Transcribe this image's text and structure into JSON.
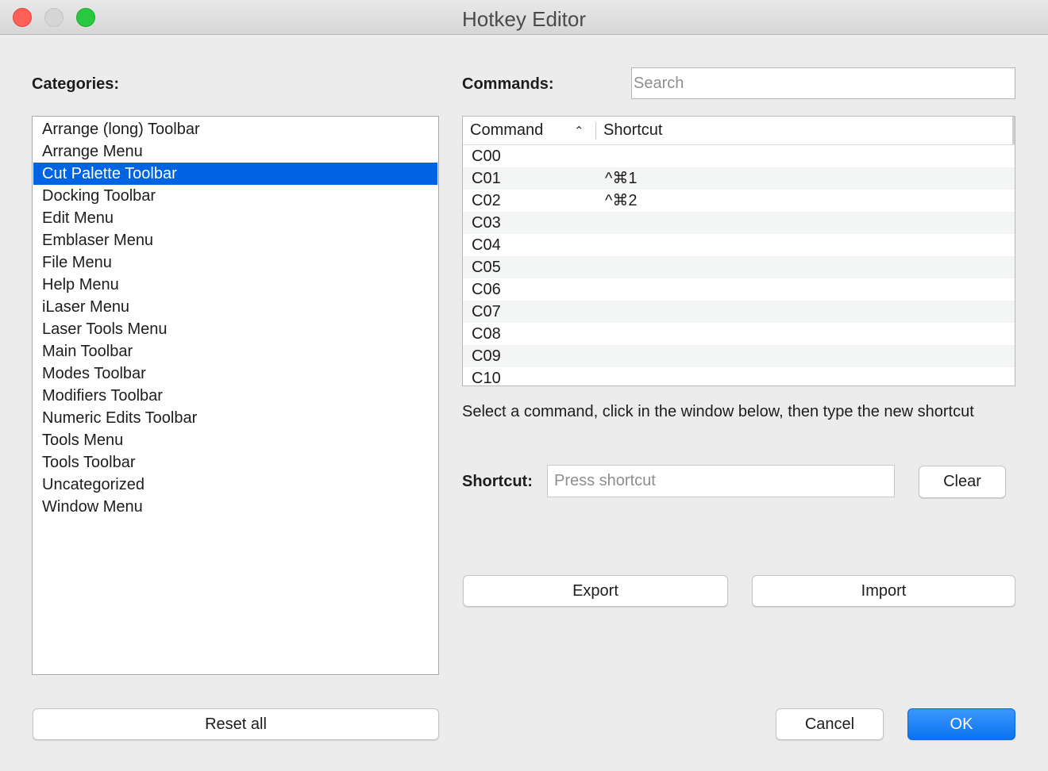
{
  "window": {
    "title": "Hotkey Editor"
  },
  "categories": {
    "label": "Categories:",
    "items": [
      {
        "label": "Arrange (long) Toolbar",
        "selected": false
      },
      {
        "label": "Arrange Menu",
        "selected": false
      },
      {
        "label": "Cut Palette Toolbar",
        "selected": true
      },
      {
        "label": "Docking Toolbar",
        "selected": false
      },
      {
        "label": "Edit Menu",
        "selected": false
      },
      {
        "label": "Emblaser Menu",
        "selected": false
      },
      {
        "label": "File Menu",
        "selected": false
      },
      {
        "label": "Help Menu",
        "selected": false
      },
      {
        "label": "iLaser Menu",
        "selected": false
      },
      {
        "label": "Laser Tools Menu",
        "selected": false
      },
      {
        "label": "Main Toolbar",
        "selected": false
      },
      {
        "label": "Modes Toolbar",
        "selected": false
      },
      {
        "label": "Modifiers Toolbar",
        "selected": false
      },
      {
        "label": "Numeric Edits Toolbar",
        "selected": false
      },
      {
        "label": "Tools Menu",
        "selected": false
      },
      {
        "label": "Tools Toolbar",
        "selected": false
      },
      {
        "label": "Uncategorized",
        "selected": false
      },
      {
        "label": "Window Menu",
        "selected": false
      }
    ]
  },
  "commands": {
    "label": "Commands:",
    "search_placeholder": "Search",
    "search_value": "",
    "columns": {
      "command": "Command",
      "shortcut": "Shortcut",
      "sort_indicator": "⌃"
    },
    "rows": [
      {
        "command": "C00",
        "shortcut": ""
      },
      {
        "command": "C01",
        "shortcut": "^⌘1"
      },
      {
        "command": "C02",
        "shortcut": "^⌘2"
      },
      {
        "command": "C03",
        "shortcut": ""
      },
      {
        "command": "C04",
        "shortcut": ""
      },
      {
        "command": "C05",
        "shortcut": ""
      },
      {
        "command": "C06",
        "shortcut": ""
      },
      {
        "command": "C07",
        "shortcut": ""
      },
      {
        "command": "C08",
        "shortcut": ""
      },
      {
        "command": "C09",
        "shortcut": ""
      },
      {
        "command": "C10",
        "shortcut": ""
      }
    ]
  },
  "hint": "Select a command, click in the window below, then type the new shortcut",
  "shortcut": {
    "label": "Shortcut:",
    "placeholder": "Press shortcut",
    "value": "",
    "clear_label": "Clear"
  },
  "actions": {
    "export_label": "Export",
    "import_label": "Import",
    "reset_label": "Reset all",
    "cancel_label": "Cancel",
    "ok_label": "OK"
  },
  "colors": {
    "selection": "#0063e1",
    "ok_button": "#0a72ef",
    "close": "#fe5f57",
    "zoom": "#28c840"
  }
}
